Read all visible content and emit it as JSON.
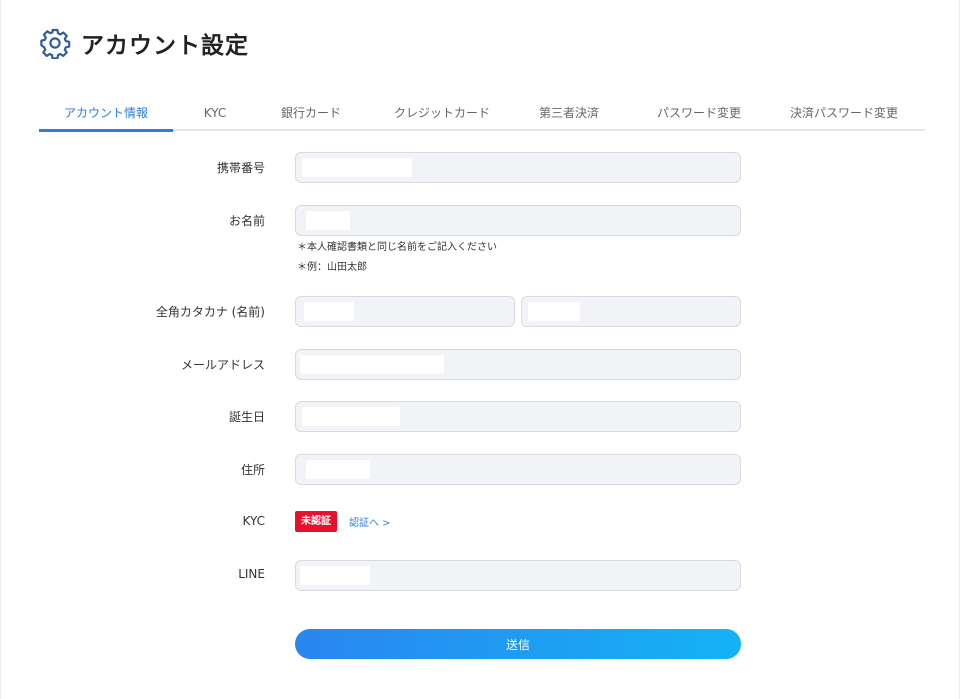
{
  "header": {
    "title": "アカウント設定",
    "icon": "gear-icon"
  },
  "tabs": [
    {
      "label": "アカウント情報",
      "active": true
    },
    {
      "label": "KYC",
      "active": false
    },
    {
      "label": "銀行カード",
      "active": false
    },
    {
      "label": "クレジットカード",
      "active": false
    },
    {
      "label": "第三者決済",
      "active": false
    },
    {
      "label": "パスワード変更",
      "active": false
    },
    {
      "label": "決済パスワード変更",
      "active": false
    }
  ],
  "form": {
    "phone_label": "携帯番号",
    "name_label": "お名前",
    "name_note_1": "＊本人確認書類と同じ名前をご記入ください",
    "name_note_2": "＊例：山田太郎",
    "kana_label": "全角カタカナ (名前)",
    "email_label": "メールアドレス",
    "birthday_label": "誕生日",
    "address_label": "住所",
    "kyc_label": "KYC",
    "kyc_status": "未認証",
    "kyc_link": "認証へ >",
    "line_label": "LINE",
    "submit_label": "送信"
  },
  "colors": {
    "accent": "#2f7fd8",
    "badge": "#e8112d",
    "field_bg": "#f2f3f6"
  }
}
